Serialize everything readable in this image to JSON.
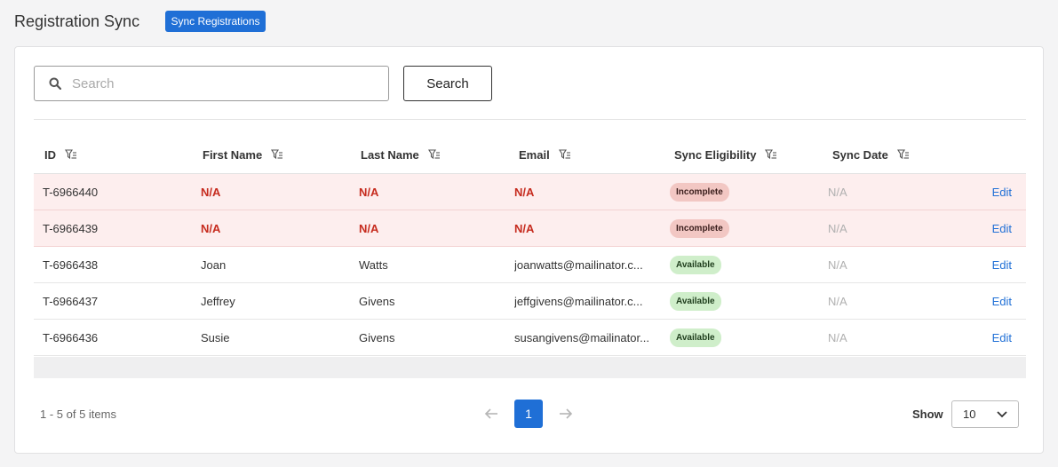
{
  "header": {
    "title": "Registration Sync",
    "sync_button": "Sync Registrations"
  },
  "search": {
    "placeholder": "Search",
    "value": "",
    "button": "Search"
  },
  "table": {
    "columns": [
      "ID",
      "First Name",
      "Last Name",
      "Email",
      "Sync Eligibility",
      "Sync Date"
    ],
    "rows": [
      {
        "id": "T-6966440",
        "first": "N/A",
        "last": "N/A",
        "email": "N/A",
        "status": "Incomplete",
        "date": "N/A",
        "action": "Edit"
      },
      {
        "id": "T-6966439",
        "first": "N/A",
        "last": "N/A",
        "email": "N/A",
        "status": "Incomplete",
        "date": "N/A",
        "action": "Edit"
      },
      {
        "id": "T-6966438",
        "first": "Joan",
        "last": "Watts",
        "email": "joanwatts@mailinator.c...",
        "status": "Available",
        "date": "N/A",
        "action": "Edit"
      },
      {
        "id": "T-6966437",
        "first": "Jeffrey",
        "last": "Givens",
        "email": "jeffgivens@mailinator.c...",
        "status": "Available",
        "date": "N/A",
        "action": "Edit"
      },
      {
        "id": "T-6966436",
        "first": "Susie",
        "last": "Givens",
        "email": "susangivens@mailinator...",
        "status": "Available",
        "date": "N/A",
        "action": "Edit"
      }
    ]
  },
  "pagination": {
    "summary": "1 - 5 of 5 items",
    "current_page": "1",
    "show_label": "Show",
    "page_size": "10"
  },
  "colors": {
    "accent": "#1f6fd6",
    "error_text": "#c62b1e",
    "error_row": "#fdeeee",
    "badge_incomplete": "#f2c7c3",
    "badge_available": "#cfeeca"
  }
}
